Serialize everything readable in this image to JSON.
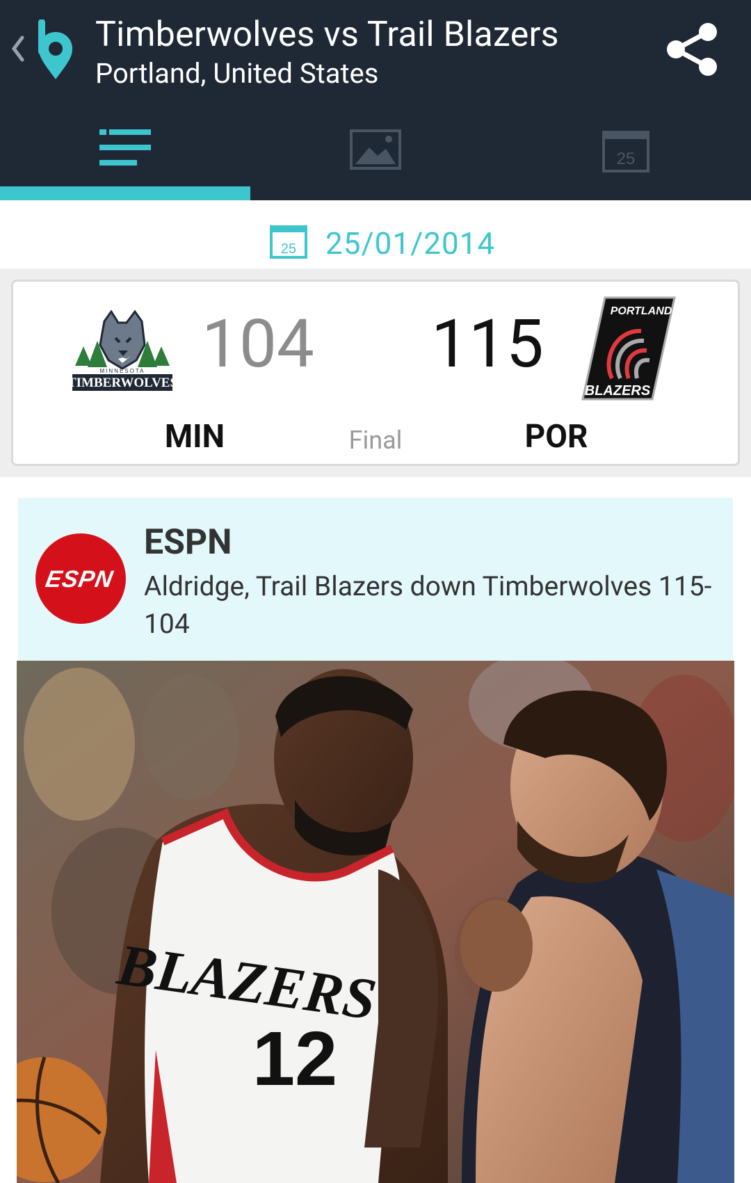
{
  "header": {
    "title": "Timberwolves vs Trail Blazers",
    "subtitle": "Portland, United States"
  },
  "tabs": [
    {
      "icon": "list-icon",
      "selected": true
    },
    {
      "icon": "image-icon",
      "selected": false
    },
    {
      "icon": "calendar-icon",
      "label": "25",
      "selected": false
    }
  ],
  "date": {
    "icon_label": "25",
    "text": "25/01/2014"
  },
  "game": {
    "away": {
      "abbr": "MIN",
      "score": "104",
      "logo_top": "MINNESOTA",
      "logo_name": "TIMBERWOLVES"
    },
    "home": {
      "abbr": "POR",
      "score": "115",
      "logo_top": "PORTLAND",
      "logo_name": "BLAZERS"
    },
    "status": "Final"
  },
  "news": {
    "source": "ESPN",
    "logo_text": "ESPN",
    "headline": "Aldridge, Trail Blazers down Timberwolves 115-104",
    "photo_jersey_text": "BLAZERS",
    "photo_jersey_number": "12"
  },
  "colors": {
    "appbar": "#1f2936",
    "accent": "#3ec6cf",
    "news_bg": "#e3f8fb",
    "espn_red": "#d4111b",
    "blazers_red": "#e03a3e"
  }
}
